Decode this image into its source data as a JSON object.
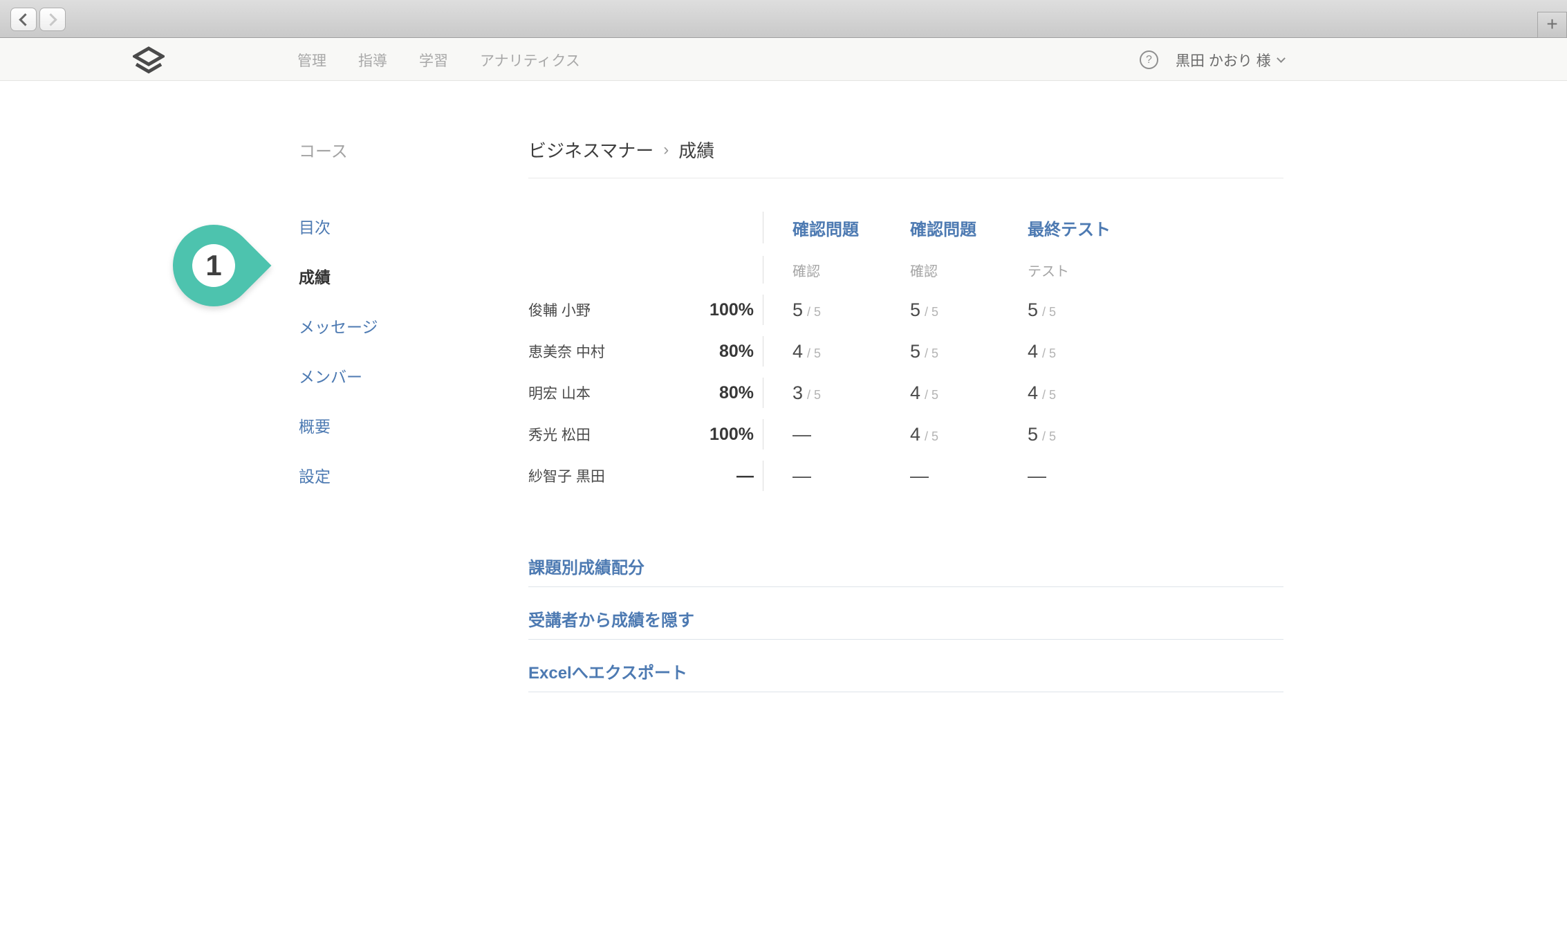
{
  "colors": {
    "accent_blue": "#4d7ab2",
    "badge_teal": "#4dc3ae",
    "text_dark": "#3e3e3e",
    "muted_gray": "#a3a3a3",
    "header_bg": "#f8f8f6"
  },
  "browser": {
    "back_icon": "chevron-left",
    "forward_icon": "chevron-right",
    "new_tab_label": "+"
  },
  "header": {
    "logo_icon": "layers-icon",
    "nav": [
      "管理",
      "指導",
      "学習",
      "アナリティクス"
    ],
    "help_label": "?",
    "user_name": "黒田 かおり 様",
    "user_chevron_icon": "chevron-down"
  },
  "sidebar": {
    "heading": "コース",
    "items": [
      {
        "label": "目次",
        "active": false
      },
      {
        "label": "成績",
        "active": true
      },
      {
        "label": "メッセージ",
        "active": false
      },
      {
        "label": "メンバー",
        "active": false
      },
      {
        "label": "概要",
        "active": false
      },
      {
        "label": "設定",
        "active": false
      }
    ]
  },
  "badge": {
    "number": "1"
  },
  "breadcrumb": {
    "course": "ビジネスマナー",
    "separator": "›",
    "current": "成績"
  },
  "grades_table": {
    "columns": [
      {
        "title": "確認問題",
        "subtitle": "確認"
      },
      {
        "title": "確認問題",
        "subtitle": "確認"
      },
      {
        "title": "最終テスト",
        "subtitle": "テスト"
      }
    ],
    "rows": [
      {
        "name": "俊輔 小野",
        "percent": "100%",
        "scores": [
          {
            "value": "5",
            "max": "/ 5"
          },
          {
            "value": "5",
            "max": "/ 5"
          },
          {
            "value": "5",
            "max": "/ 5"
          }
        ]
      },
      {
        "name": "恵美奈 中村",
        "percent": "80%",
        "scores": [
          {
            "value": "4",
            "max": "/ 5"
          },
          {
            "value": "5",
            "max": "/ 5"
          },
          {
            "value": "4",
            "max": "/ 5"
          }
        ]
      },
      {
        "name": "明宏 山本",
        "percent": "80%",
        "scores": [
          {
            "value": "3",
            "max": "/ 5"
          },
          {
            "value": "4",
            "max": "/ 5"
          },
          {
            "value": "4",
            "max": "/ 5"
          }
        ]
      },
      {
        "name": "秀光 松田",
        "percent": "100%",
        "scores": [
          {
            "value": "—",
            "max": ""
          },
          {
            "value": "4",
            "max": "/ 5"
          },
          {
            "value": "5",
            "max": "/ 5"
          }
        ]
      },
      {
        "name": "紗智子 黒田",
        "percent": "—",
        "scores": [
          {
            "value": "—",
            "max": ""
          },
          {
            "value": "—",
            "max": ""
          },
          {
            "value": "—",
            "max": ""
          }
        ]
      }
    ]
  },
  "actions": [
    {
      "label": "課題別成績配分"
    },
    {
      "label": "受講者から成績を隠す"
    },
    {
      "label": "Excelへエクスポート"
    }
  ]
}
